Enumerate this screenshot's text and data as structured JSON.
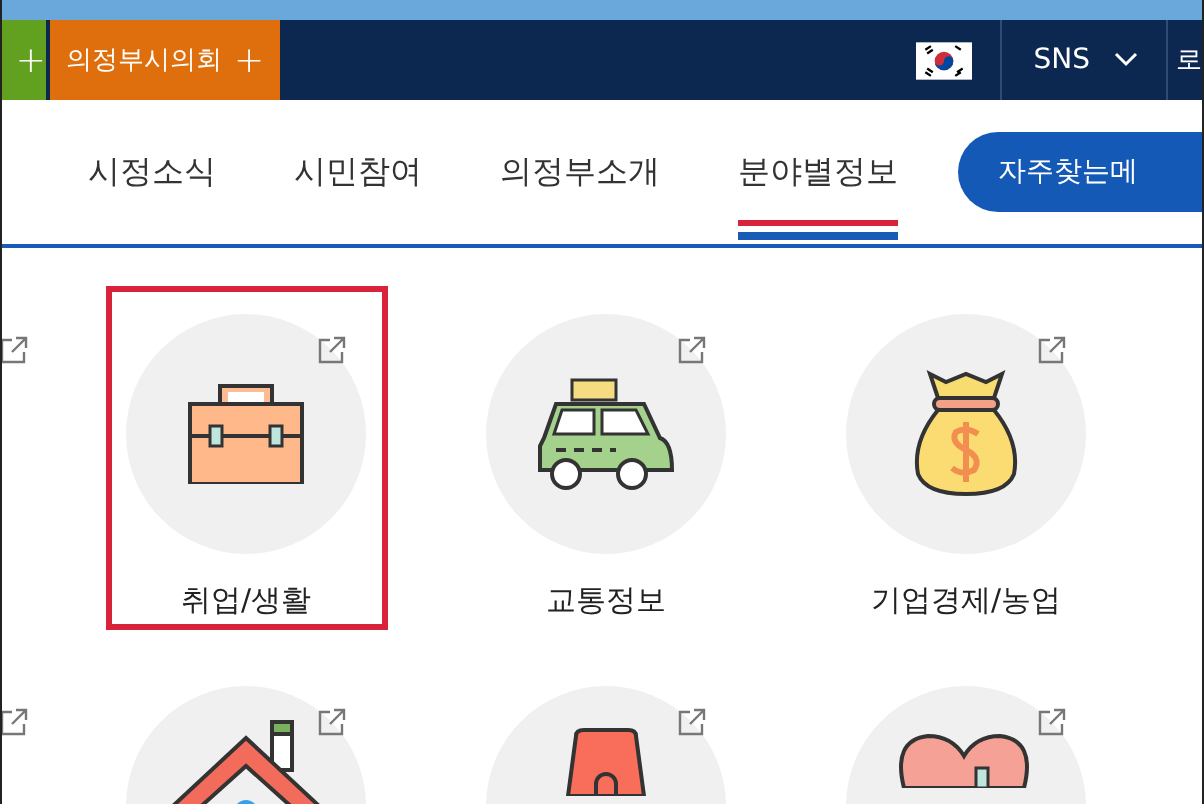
{
  "site_tabs": [
    {
      "icon": "+",
      "color": "#62a01f"
    },
    {
      "label": "의정부시의회",
      "icon": "+",
      "color": "#df6f0c"
    }
  ],
  "utility": {
    "sns": "SNS",
    "cut_link": "로"
  },
  "nav": [
    {
      "label": "시정소식",
      "selected": false
    },
    {
      "label": "시민참여",
      "selected": false
    },
    {
      "label": "의정부소개",
      "selected": false
    },
    {
      "label": "분야별정보",
      "selected": true
    }
  ],
  "faq_button": "자주찾는메",
  "category_rows": [
    [
      {
        "kind": "partial",
        "selected": false
      },
      {
        "kind": "briefcase",
        "label": "취업/생활",
        "selected": true
      },
      {
        "kind": "car",
        "label": "교통정보",
        "selected": false
      },
      {
        "kind": "moneybag",
        "label": "기업경제/농업",
        "selected": false
      }
    ],
    [
      {
        "kind": "partial",
        "selected": false
      },
      {
        "kind": "house",
        "selected": false
      },
      {
        "kind": "pouch",
        "selected": false
      },
      {
        "kind": "hearts",
        "selected": false
      }
    ]
  ]
}
